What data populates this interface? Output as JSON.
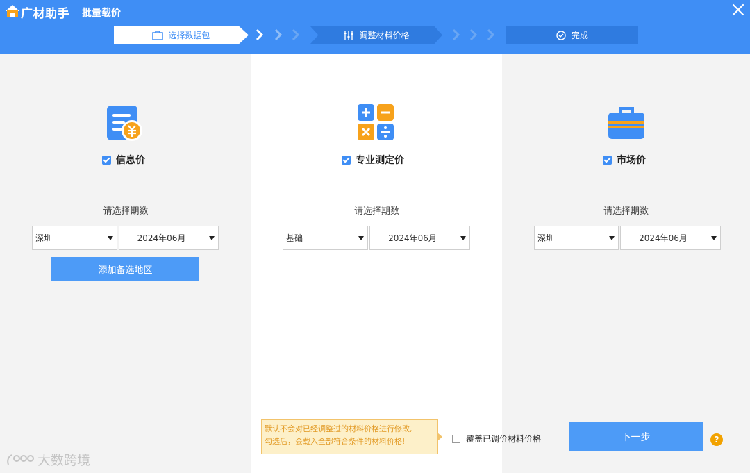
{
  "app": {
    "name": "广材助手",
    "title": "批量载价"
  },
  "steps": [
    {
      "label": "选择数据包",
      "icon": "package-icon"
    },
    {
      "label": "调整材料价格",
      "icon": "sliders-icon"
    },
    {
      "label": "完成",
      "icon": "check-circle-icon"
    }
  ],
  "columns": [
    {
      "icon": "info-price-icon",
      "checkbox_label": "信息价",
      "checked": true,
      "period_label": "请选择期数",
      "region": "深圳",
      "period": "2024年06月",
      "add_button": "添加备选地区"
    },
    {
      "icon": "calculator-icon",
      "checkbox_label": "专业测定价",
      "checked": true,
      "period_label": "请选择期数",
      "region": "基础",
      "period": "2024年06月"
    },
    {
      "icon": "briefcase-icon",
      "checkbox_label": "市场价",
      "checked": true,
      "period_label": "请选择期数",
      "region": "深圳",
      "period": "2024年06月"
    }
  ],
  "footer": {
    "tooltip_line1": "默认不会对已经调整过的材料价格进行修改,",
    "tooltip_line2": "勾选后，会载入全部符合条件的材料价格!",
    "override_label": "覆盖已调价材料价格",
    "override_checked": false,
    "next_button": "下一步",
    "help": "?"
  },
  "watermark": "大数跨境",
  "colors": {
    "accent": "#3f8ef5",
    "button": "#4d9bf7",
    "warning": "#e29a25",
    "help": "#f2a200"
  }
}
